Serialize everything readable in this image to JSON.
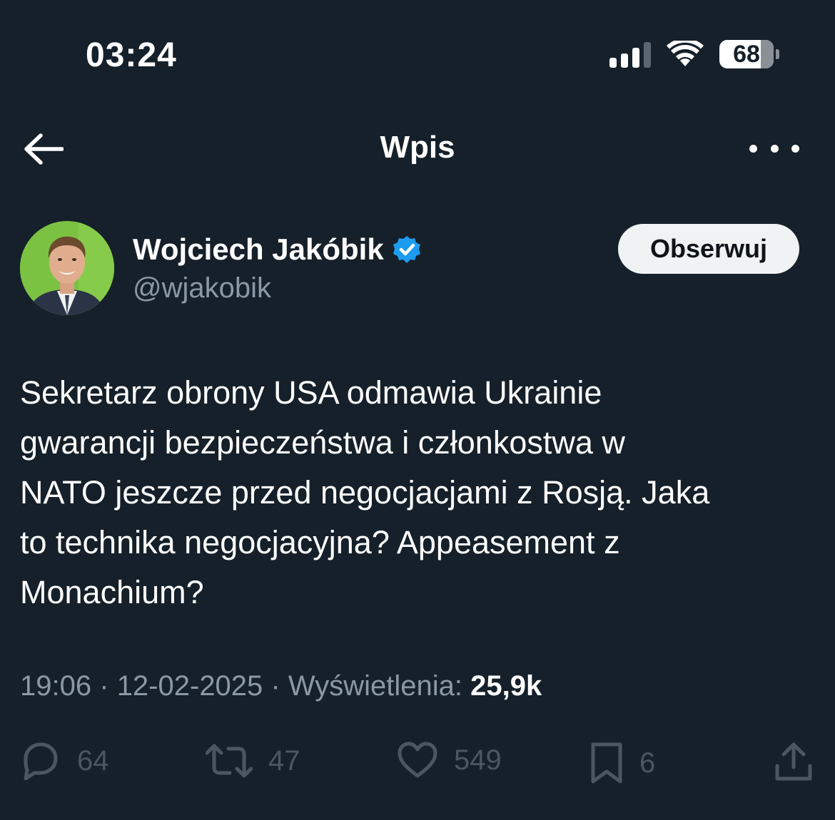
{
  "status_bar": {
    "time": "03:24",
    "battery_level": "68",
    "icons": [
      "signal-icon",
      "wifi-icon",
      "battery-icon"
    ]
  },
  "header": {
    "title": "Wpis",
    "icons": [
      "back-arrow-icon",
      "more-options-icon"
    ]
  },
  "author": {
    "display_name": "Wojciech Jakóbik",
    "handle": "@wjakobik",
    "verified": true,
    "verified_color": "#1d9bf0",
    "follow_label": "Obserwuj"
  },
  "tweet": {
    "text": "Sekretarz obrony USA odmawia Ukrainie\ngwarancji bezpieczeństwa i członkostwa w\nNATO jeszcze przed negocjacjami z Rosją. Jaka\nto technika negocjacyjna? Appeasement z\nMonachium?"
  },
  "meta": {
    "time": "19:06",
    "date": "12-02-2025",
    "views_label": "Wyświetlenia:",
    "views_count": "25,9k",
    "separator": "·"
  },
  "actions": {
    "replies": "64",
    "reposts": "47",
    "likes": "549",
    "bookmarks": "6",
    "icons": [
      "reply-icon",
      "repost-icon",
      "like-icon",
      "bookmark-icon",
      "share-icon"
    ]
  },
  "colors": {
    "background": "#16202a",
    "text_primary": "#ffffff",
    "text_secondary": "#8b98a5",
    "follow_button_bg": "#eff3f4"
  }
}
